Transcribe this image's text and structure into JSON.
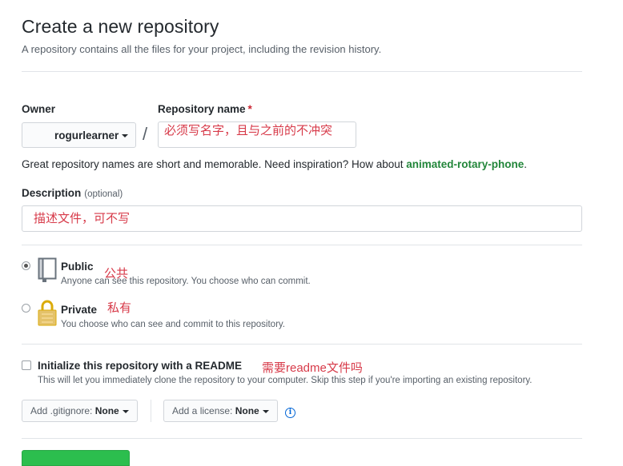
{
  "header": {
    "title": "Create a new repository",
    "subtitle": "A repository contains all the files for your project, including the revision history."
  },
  "owner": {
    "label": "Owner",
    "value": "rogurlearner"
  },
  "repo_name": {
    "label": "Repository name",
    "required_mark": "*",
    "annotation": "必须写名字，且与之前的不冲突"
  },
  "separator": "/",
  "name_hint": {
    "prefix": "Great repository names are short and memorable. Need inspiration? How about ",
    "suggestion": "animated-rotary-phone",
    "suffix": "."
  },
  "description": {
    "label": "Description",
    "optional": "(optional)",
    "annotation": "描述文件，可不写"
  },
  "visibility": {
    "public": {
      "title": "Public",
      "desc": "Anyone can see this repository. You choose who can commit.",
      "annotation": "公共",
      "selected": true
    },
    "private": {
      "title": "Private",
      "desc": "You choose who can see and commit to this repository.",
      "annotation": "私有",
      "selected": false
    }
  },
  "readme": {
    "label": "Initialize this repository with a README",
    "desc": "This will let you immediately clone the repository to your computer. Skip this step if you're importing an existing repository.",
    "annotation": "需要readme文件吗",
    "checked": false
  },
  "gitignore": {
    "prefix": "Add .gitignore: ",
    "value": "None"
  },
  "license": {
    "prefix": "Add a license: ",
    "value": "None"
  },
  "info_icon": "i",
  "colors": {
    "annotation": "#d73a49",
    "suggestion": "#22863a",
    "required": "#cb2431",
    "create_button": "#2cbe4e",
    "info": "#0366d6"
  }
}
